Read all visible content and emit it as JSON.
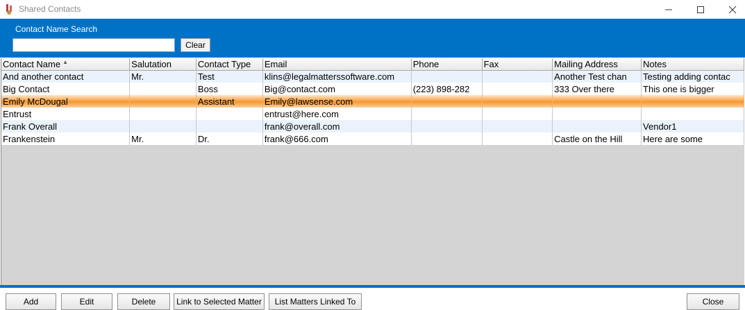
{
  "window": {
    "title": "Shared Contacts"
  },
  "search": {
    "label": "Contact Name Search",
    "value": "",
    "clear_label": "Clear"
  },
  "grid": {
    "columns": [
      "Contact Name",
      "Salutation",
      "Contact Type",
      "Email",
      "Phone",
      "Fax",
      "Mailing Address",
      "Notes"
    ],
    "sorted_column": "Contact Name",
    "rows": [
      [
        "And another contact",
        "Mr.",
        "Test",
        "klins@legalmatterssoftware.com",
        "",
        "",
        "Another Test chan",
        "Testing adding contac"
      ],
      [
        "Big Contact",
        "",
        "Boss",
        "Big@contact.com",
        "(223) 898-282",
        "",
        "333 Over there",
        "This one is bigger"
      ],
      [
        "Emily McDougal",
        "",
        "Assistant",
        "Emily@lawsense.com",
        "",
        "",
        "",
        ""
      ],
      [
        "Entrust",
        "",
        "",
        "entrust@here.com",
        "",
        "",
        "",
        ""
      ],
      [
        "Frank Overall",
        "",
        "",
        "frank@overall.com",
        "",
        "",
        "",
        "Vendor1"
      ],
      [
        "Frankenstein",
        "Mr.",
        "Dr.",
        "frank@666.com",
        "",
        "",
        "Castle on the Hill",
        "Here are some"
      ]
    ],
    "selected_row": 2
  },
  "buttons": {
    "add": "Add",
    "edit": "Edit",
    "delete": "Delete",
    "link": "Link to Selected Matter",
    "list": "List Matters Linked To",
    "close": "Close"
  },
  "colors": {
    "accent": "#0072c6",
    "selection": "#f7972c"
  }
}
